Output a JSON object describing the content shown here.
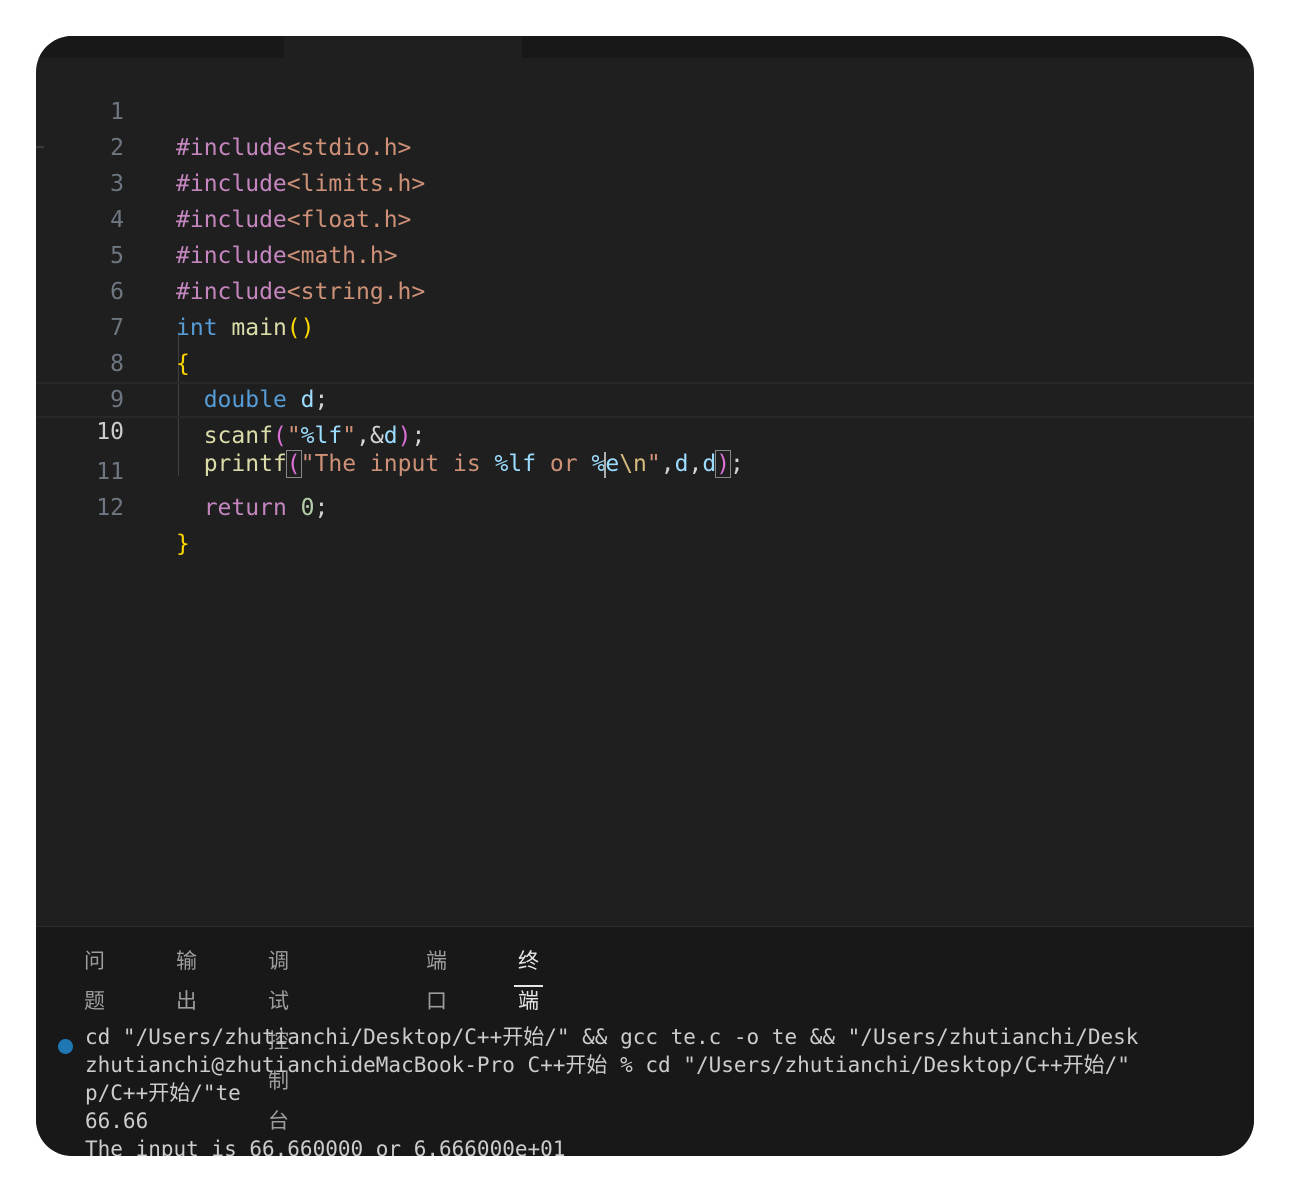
{
  "editor": {
    "lines": [
      {
        "num": "1"
      },
      {
        "num": "2"
      },
      {
        "num": "3"
      },
      {
        "num": "4"
      },
      {
        "num": "5"
      },
      {
        "num": "6"
      },
      {
        "num": "7"
      },
      {
        "num": "8"
      },
      {
        "num": "9"
      },
      {
        "num": "10"
      },
      {
        "num": "11"
      },
      {
        "num": "12"
      }
    ],
    "code": {
      "inc": "#include",
      "h1": "<stdio.h>",
      "h2": "<limits.h>",
      "h3": "<float.h>",
      "h4": "<math.h>",
      "h5": "<string.h>",
      "int": "int",
      "main": "main",
      "lparen": "(",
      "rparen": ")",
      "lbrace": "{",
      "rbrace": "}",
      "double": "double",
      "d": "d",
      "semi": ";",
      "scanf": "scanf",
      "quote": "\"",
      "fmt_lf": "%lf",
      "comma": ",",
      "amp": "&",
      "printf": "printf",
      "str_the": "The input is ",
      "str_or": " or ",
      "pct": "%",
      "e": "e",
      "esc_n": "\\n",
      "return": "return",
      "zero": "0"
    }
  },
  "panel": {
    "tabs": [
      "问题",
      "输出",
      "调试控制台",
      "端口",
      "终端"
    ],
    "active_tab": "终端"
  },
  "terminal": {
    "lines": [
      "cd \"/Users/zhutianchi/Desktop/C++开始/\" && gcc te.c -o te && \"/Users/zhutianchi/Desk",
      "zhutianchi@zhutianchideMacBook-Pro C++开始 % cd \"/Users/zhutianchi/Desktop/C++开始/\"",
      "p/C++开始/\"te",
      "66.66",
      "The input is 66.660000 or 6.666000e+01"
    ]
  },
  "colors": {
    "editor_bg": "#1f1f1f",
    "panel_bg": "#181818",
    "keyword_preprocessor": "#c586c0",
    "string": "#ce9178",
    "type": "#569cd6",
    "function": "#dcdcaa",
    "variable": "#9cdcfe",
    "bracket_level1": "#ffd700",
    "bracket_level2": "#da70d6",
    "terminal_dot": "#1f78b4"
  }
}
